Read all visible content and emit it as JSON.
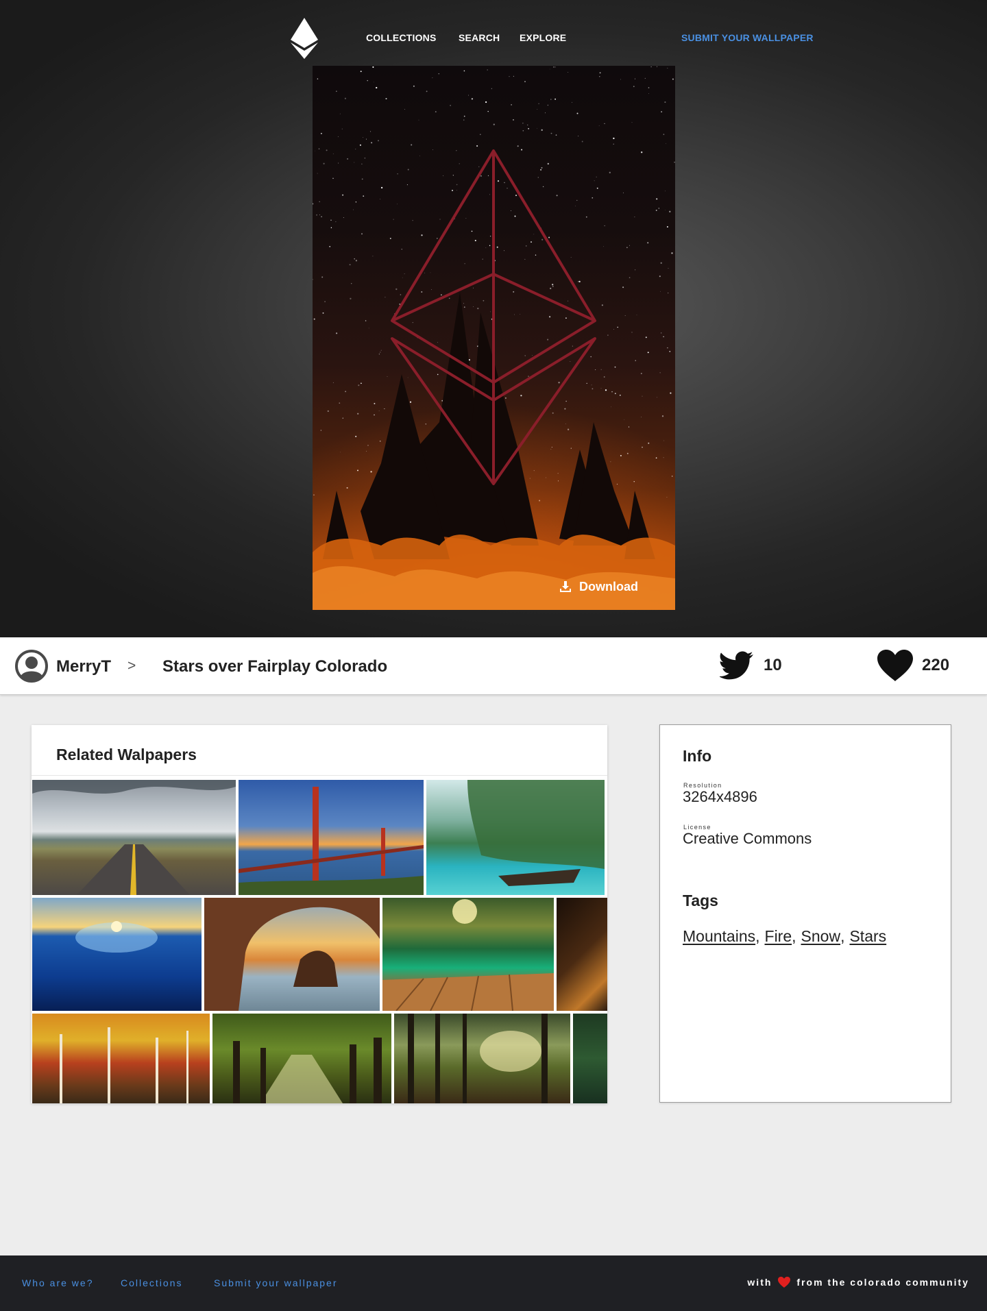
{
  "nav": {
    "collections": "COLLECTIONS",
    "search": "SEARCH",
    "explore": "EXPLORE",
    "submit": "SUBMIT YOUR WALLPAPER"
  },
  "hero": {
    "download_label": "Download"
  },
  "author_bar": {
    "author": "MerryT",
    "separator": ">",
    "title": "Stars over Fairplay Colorado",
    "twitter_count": "10",
    "likes_count": "220"
  },
  "related": {
    "title": "Related Walpapers"
  },
  "info": {
    "title": "Info",
    "resolution_label": "Resolution",
    "resolution": "3264x4896",
    "license_label": "License",
    "license": "Creative Commons",
    "tags_title": "Tags",
    "tags": [
      "Mountains",
      "Fire",
      "Snow",
      "Stars"
    ]
  },
  "footer": {
    "who": "Who are we?",
    "collections": "Collections",
    "submit": "Submit your wallpaper",
    "credit_prefix": "with",
    "credit_suffix": "from the colorado community"
  },
  "colors": {
    "accent": "#4a90e2",
    "heart_red": "#e0201f",
    "ethereum_outline": "#8a1e2a",
    "footer_bg": "#1f2024"
  }
}
